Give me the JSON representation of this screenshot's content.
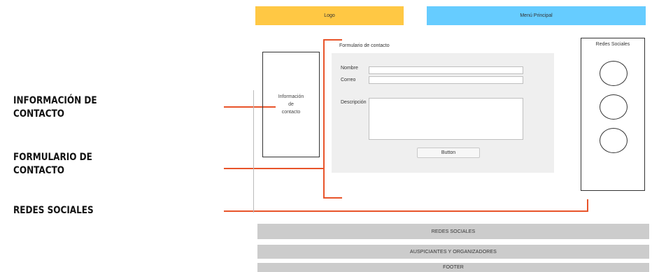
{
  "header": {
    "logo_label": "Logo",
    "menu_label": "Menú Principal"
  },
  "contact_info_box": {
    "lines": [
      "Información",
      "de",
      "contacto"
    ]
  },
  "contact_form": {
    "title": "Formulario de contacto",
    "name_label": "Nombre",
    "name_value": "",
    "email_label": "Correo",
    "email_value": "",
    "description_label": "Descripción",
    "description_value": "",
    "button_label": "Button"
  },
  "social_box": {
    "title": "Redes Sociales",
    "icon_count": 3
  },
  "bottom_bars": [
    "REDES SOCIALES",
    "AUSPICIANTES Y ORGANIZADORES",
    "FOOTER"
  ],
  "callouts": {
    "contact_info": [
      "INFORMACIÓN DE",
      "CONTACTO"
    ],
    "contact_form": [
      "FORMULARIO DE",
      "CONTACTO"
    ],
    "social": [
      "REDES SOCIALES"
    ]
  },
  "colors": {
    "logo": "#ffc844",
    "menu": "#66ccff",
    "connector": "#e8542a",
    "bar": "#cccccc",
    "panel": "#efefef"
  }
}
